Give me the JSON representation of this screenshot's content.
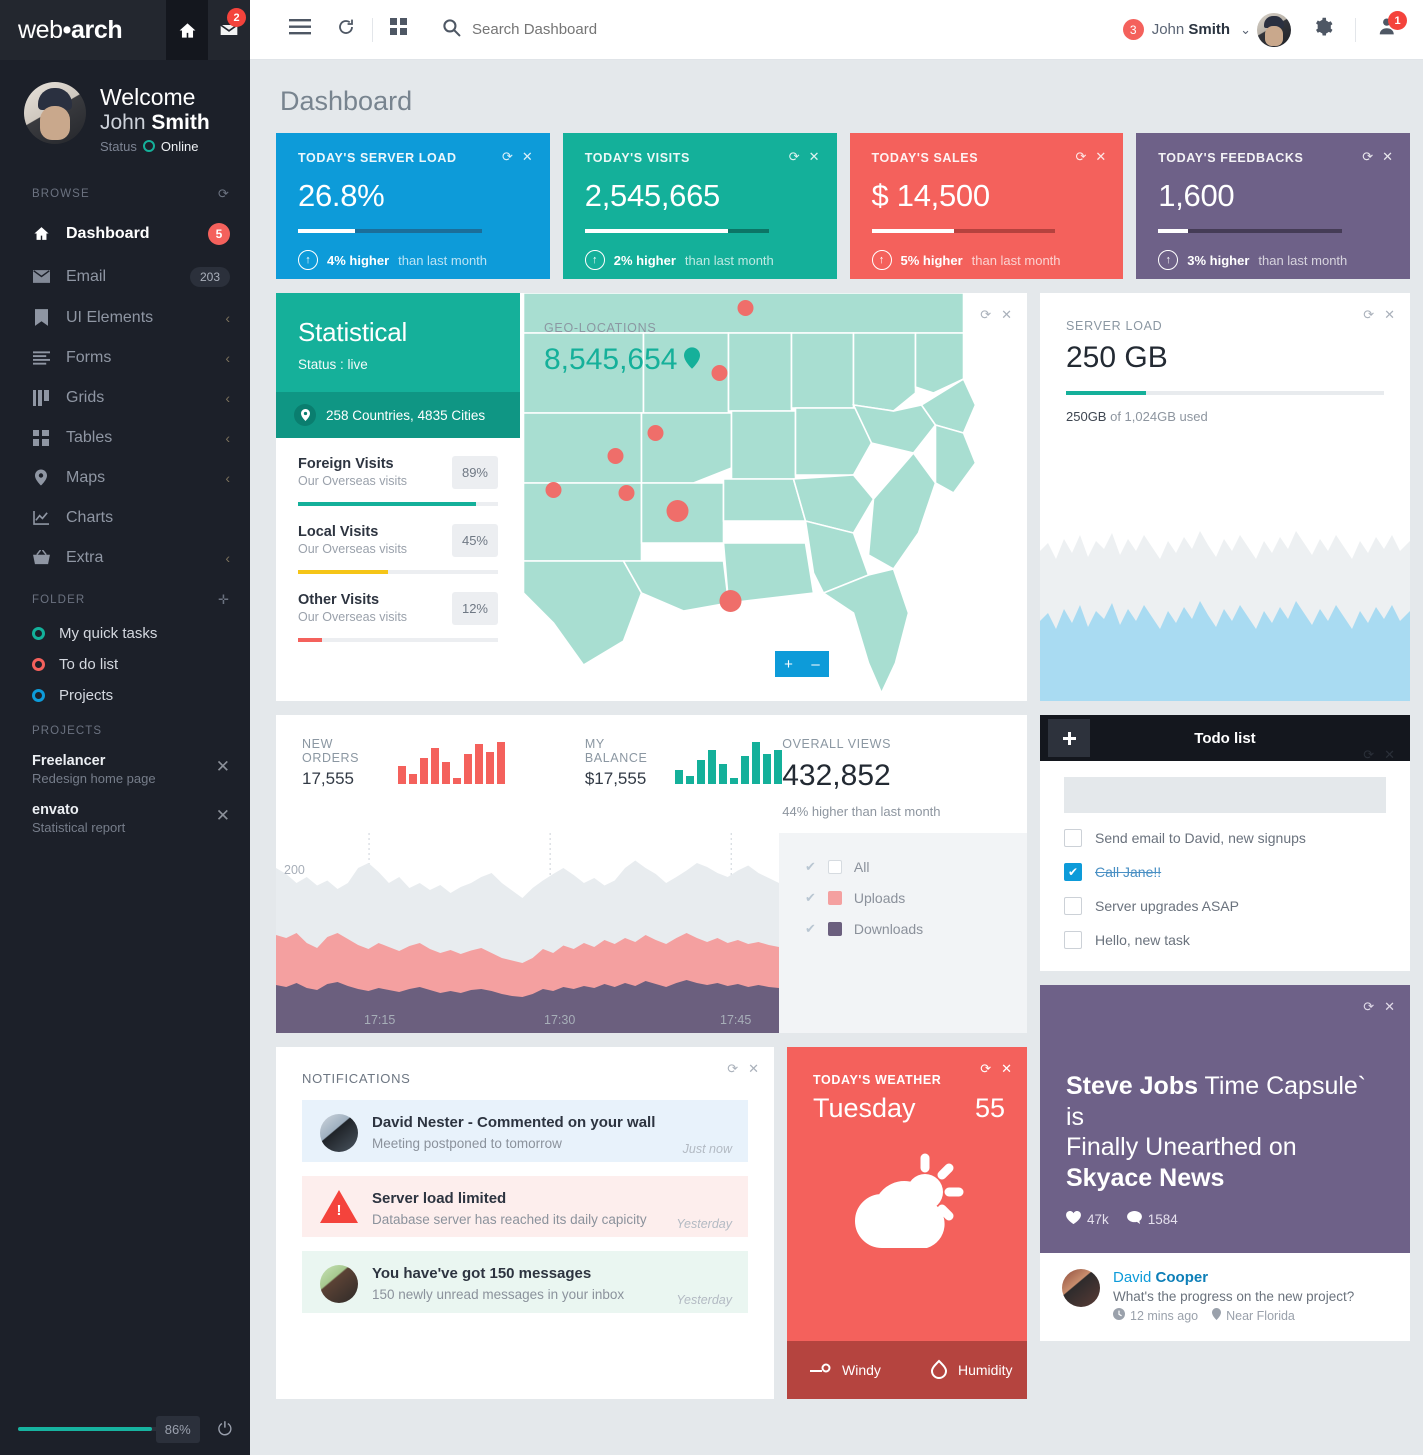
{
  "brand": {
    "name_light": "web",
    "dot": "•",
    "name_bold": "arch",
    "home_icon": "home-icon",
    "mail_icon": "mail-icon",
    "mail_badge": "2"
  },
  "profile": {
    "welcome": "Welcome",
    "first": "John ",
    "last": "Smith",
    "status_label": "Status",
    "status_value": "Online"
  },
  "sidebar": {
    "browse_label": "BROWSE",
    "refresh_icon": "refresh-icon",
    "items": [
      {
        "label": "Dashboard",
        "icon": "home-icon",
        "badge": "5",
        "badge_type": "red",
        "active": true
      },
      {
        "label": "Email",
        "icon": "envelope-icon",
        "badge": "203",
        "badge_type": "dark"
      },
      {
        "label": "UI Elements",
        "icon": "bookmark-icon",
        "chevron": "‹"
      },
      {
        "label": "Forms",
        "icon": "list-icon",
        "chevron": "‹"
      },
      {
        "label": "Grids",
        "icon": "grid-columns-icon",
        "chevron": "‹"
      },
      {
        "label": "Tables",
        "icon": "table-icon",
        "chevron": "‹"
      },
      {
        "label": "Maps",
        "icon": "map-pin-icon",
        "chevron": "‹"
      },
      {
        "label": "Charts",
        "icon": "chart-icon"
      },
      {
        "label": "Extra",
        "icon": "basket-icon",
        "chevron": "‹"
      }
    ],
    "folder_label": "FOLDER",
    "folder_add_icon": "plus-icon",
    "folders": [
      {
        "label": "My quick tasks",
        "color": "#13b19b"
      },
      {
        "label": "To do list",
        "color": "#f4615c"
      },
      {
        "label": "Projects",
        "color": "#0d9bd9"
      }
    ],
    "projects_label": "PROJECTS",
    "projects": [
      {
        "title": "Freelancer",
        "subtitle": "Redesign home page",
        "close_icon": "close-icon"
      },
      {
        "title": "envato",
        "subtitle": "Statistical report",
        "close_icon": "close-icon"
      }
    ],
    "battery_percent": "86%",
    "battery_value": 86,
    "power_icon": "power-icon"
  },
  "topbar": {
    "menu_icon": "hamburger-icon",
    "refresh_icon": "refresh-icon",
    "grid_icon": "grid-icon",
    "search_icon": "search-icon",
    "search_placeholder": "Search Dashboard",
    "search_value": "",
    "user_badge": "3",
    "user_first": "John ",
    "user_last": "Smith",
    "chevron": "⌄",
    "gear_icon": "gear-icon",
    "user_icon": "user-icon",
    "user_icon_badge": "1"
  },
  "page": {
    "title": "Dashboard"
  },
  "stats": [
    {
      "title": "TODAY'S SERVER LOAD",
      "value": "26.8%",
      "bg": "#0d9bd9",
      "bar_bg": "#1b6e9a",
      "bar_pct": 31,
      "delta": "4% higher",
      "delta_suffix": "than last month",
      "arrow": "arrow-up-icon",
      "refresh_icon": "refresh-icon",
      "close_icon": "close-icon"
    },
    {
      "title": "TODAY'S VISITS",
      "value": "2,545,665",
      "bg": "#14b09a",
      "bar_bg": "#0c7566",
      "bar_pct": 78,
      "delta": "2% higher",
      "delta_suffix": "than last month",
      "arrow": "arrow-up-icon",
      "refresh_icon": "refresh-icon",
      "close_icon": "close-icon"
    },
    {
      "title": "TODAY'S SALES",
      "value": "$ 14,500",
      "bg": "#f4615c",
      "bar_bg": "#b5423e",
      "bar_pct": 45,
      "delta": "5% higher",
      "delta_suffix": "than last month",
      "arrow": "arrow-up-icon",
      "refresh_icon": "refresh-icon",
      "close_icon": "close-icon"
    },
    {
      "title": "TODAY'S FEEDBACKS",
      "value": "1,600",
      "bg": "#6e6188",
      "bar_bg": "#453c56",
      "bar_pct": 16,
      "delta": "3% higher",
      "delta_suffix": "than last month",
      "arrow": "arrow-up-icon",
      "refresh_icon": "refresh-icon",
      "close_icon": "close-icon"
    }
  ],
  "statistical": {
    "title": "Statistical",
    "status": "Status : live",
    "geo_summary": "258 Countries, 4835 Cities",
    "pin_icon": "map-pin-icon",
    "visits": [
      {
        "title": "Foreign Visits",
        "sub": "Our Overseas visits",
        "pct": "89%",
        "value": 89,
        "color": "#14b09a"
      },
      {
        "title": "Local Visits",
        "sub": "Our Overseas visits",
        "pct": "45%",
        "value": 45,
        "color": "#f5c518"
      },
      {
        "title": "Other Visits",
        "sub": "Our Overseas visits",
        "pct": "12%",
        "value": 12,
        "color": "#f4615c"
      }
    ]
  },
  "geo": {
    "label": "GEO-LOCATIONS",
    "count": "8,545,654",
    "pin_icon": "map-pin-icon",
    "zoom_in": "+",
    "zoom_out": "–",
    "refresh_icon": "refresh-icon",
    "close_icon": "close-icon"
  },
  "server_load": {
    "label": "SERVER LOAD",
    "value": "250 GB",
    "used_prefix": "250GB",
    "used_mid": " of 1,024GB ",
    "used_suffix": "used",
    "bar_pct": 25,
    "refresh_icon": "refresh-icon",
    "close_icon": "close-icon"
  },
  "todo": {
    "title": "Todo list",
    "add_icon": "plus-icon",
    "input_placeholder": "",
    "input_value": "",
    "refresh_icon": "refresh-icon",
    "close_icon": "close-icon",
    "items": [
      {
        "label": "Send email to David, new signups",
        "done": false
      },
      {
        "label": "Call Jane!!",
        "done": true
      },
      {
        "label": "Server upgrades ASAP",
        "done": false
      },
      {
        "label": "Hello, new task",
        "done": false
      }
    ]
  },
  "news": {
    "bold1": "Steve Jobs",
    "rest1": " Time Capsule` is",
    "line2": "Finally Unearthed on",
    "bold2": "Skyace News",
    "likes": "47k",
    "comments": "1584",
    "heart_icon": "heart-icon",
    "comment_icon": "comment-icon",
    "refresh_icon": "refresh-icon",
    "close_icon": "close-icon",
    "bg": "#6e6188"
  },
  "comment": {
    "first": "David ",
    "last": "Cooper",
    "text": "What's the progress on the new project?",
    "time": "12 mins ago",
    "place": "Near Florida",
    "clock_icon": "clock-icon",
    "pin_icon": "map-pin-icon",
    "avatar": "avatar"
  },
  "chart_data": {
    "type": "area",
    "title": "",
    "xlabel": "",
    "ylabel": "",
    "x_ticks": [
      "17:15",
      "17:30",
      "17:45"
    ],
    "y_ticks": [
      "200"
    ],
    "ylim": [
      0,
      400
    ],
    "grid": true,
    "legend_position": "right",
    "series": [
      {
        "name": "All",
        "color": "#e8ecef",
        "checked": false,
        "values": [
          330,
          318,
          300,
          312,
          295,
          305,
          288,
          300,
          330,
          340,
          322,
          300,
          312,
          290,
          300,
          286,
          296,
          280,
          292,
          300,
          312,
          320,
          300,
          285,
          270,
          290,
          305,
          318,
          330,
          316,
          300,
          310,
          295,
          305,
          330,
          345,
          330,
          318,
          300,
          312,
          325,
          340,
          332,
          320,
          312,
          325,
          335,
          320,
          310,
          300
        ]
      },
      {
        "name": "Uploads",
        "color": "#f4a0a0",
        "checked": true,
        "values": [
          196,
          190,
          200,
          180,
          170,
          192,
          200,
          188,
          176,
          168,
          180,
          172,
          164,
          174,
          180,
          168,
          160,
          166,
          158,
          165,
          170,
          160,
          150,
          145,
          140,
          150,
          168,
          160,
          175,
          168,
          180,
          172,
          186,
          178,
          190,
          182,
          196,
          186,
          178,
          190,
          200,
          190,
          182,
          190,
          180,
          186,
          178,
          182,
          176,
          172
        ]
      },
      {
        "name": "Downloads",
        "color": "#6b5f7e",
        "checked": true,
        "values": [
          96,
          92,
          100,
          90,
          86,
          98,
          102,
          94,
          88,
          84,
          90,
          86,
          82,
          88,
          92,
          86,
          80,
          84,
          80,
          86,
          88,
          84,
          78,
          74,
          72,
          78,
          88,
          84,
          92,
          88,
          94,
          90,
          98,
          92,
          100,
          94,
          104,
          98,
          92,
          100,
          106,
          100,
          96,
          100,
          94,
          98,
          92,
          96,
          92,
          90
        ]
      }
    ]
  },
  "chart_panel": {
    "new_orders_label": "NEW ORDERS",
    "new_orders_value": "17,555",
    "new_orders_spark": [
      18,
      10,
      26,
      36,
      22,
      6,
      30,
      40,
      32,
      42
    ],
    "new_orders_color": "#f4615c",
    "my_balance_label": "MY BALANCE",
    "my_balance_value": "$17,555",
    "my_balance_spark": [
      14,
      8,
      24,
      34,
      20,
      6,
      28,
      42,
      30,
      34
    ],
    "my_balance_color": "#14b09a",
    "overall_label": "OVERALL VIEWS",
    "overall_value": "432,852",
    "overall_sub": "44% higher than last month"
  },
  "notifications": {
    "title": "NOTIFICATIONS",
    "refresh_icon": "refresh-icon",
    "close_icon": "close-icon",
    "items": [
      {
        "title": "David Nester - Commented on your wall",
        "sub": "Meeting postponed to tomorrow",
        "time": "Just now",
        "kind": "blue",
        "icon": "avatar"
      },
      {
        "title": "Server load limited",
        "sub": "Database server has reached its daily capicity",
        "time": "Yesterday",
        "kind": "red",
        "icon": "warning-icon"
      },
      {
        "title": "You have've got 150 messages",
        "sub": "150 newly unread messages in your inbox",
        "time": "Yesterday",
        "kind": "green",
        "icon": "avatar"
      }
    ]
  },
  "weather": {
    "label": "TODAY'S WEATHER",
    "day": "Tuesday",
    "temp": "55",
    "icon": "sun-cloud-icon",
    "wind_label": "Windy",
    "wind_icon": "wind-icon",
    "humidity_label": "Humidity",
    "humidity_icon": "droplet-icon",
    "refresh_icon": "refresh-icon",
    "close_icon": "close-icon",
    "bg": "#f4615c"
  }
}
